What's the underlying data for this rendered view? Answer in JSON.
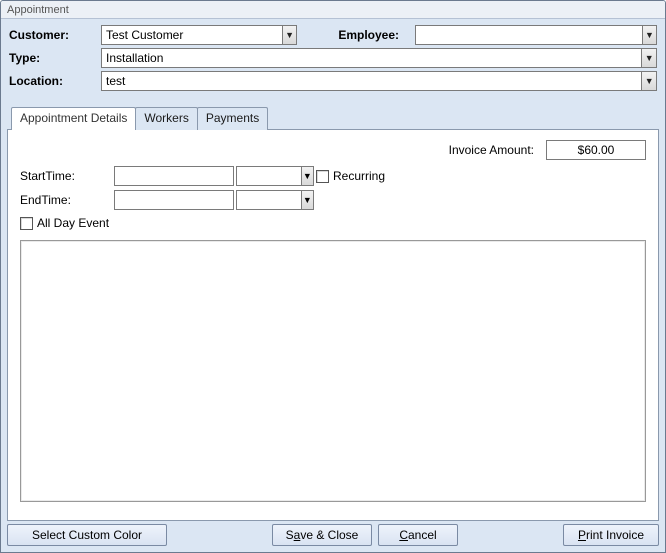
{
  "window": {
    "title": "Appointment"
  },
  "header": {
    "customer_label": "Customer:",
    "customer_value": "Test Customer",
    "employee_label": "Employee:",
    "employee_value": "",
    "type_label": "Type:",
    "type_value": "Installation",
    "location_label": "Location:",
    "location_value": "test"
  },
  "tabs": {
    "details": "Appointment Details",
    "workers": "Workers",
    "payments": "Payments"
  },
  "details": {
    "invoice_label": "Invoice Amount:",
    "invoice_value": "$60.00",
    "start_label": "StartTime:",
    "start_date": "",
    "start_time": "",
    "end_label": "EndTime:",
    "end_date": "",
    "end_time": "",
    "recurring_label": "Recurring",
    "allday_label": "All Day Event",
    "notes": ""
  },
  "footer": {
    "select_color": "Select Custom Color",
    "save_close_pre": "S",
    "save_close_mid": "a",
    "save_close_post": "ve & Close",
    "cancel_pre": "",
    "cancel_mid": "C",
    "cancel_post": "ancel",
    "print_pre": "",
    "print_mid": "P",
    "print_post": "rint Invoice"
  }
}
